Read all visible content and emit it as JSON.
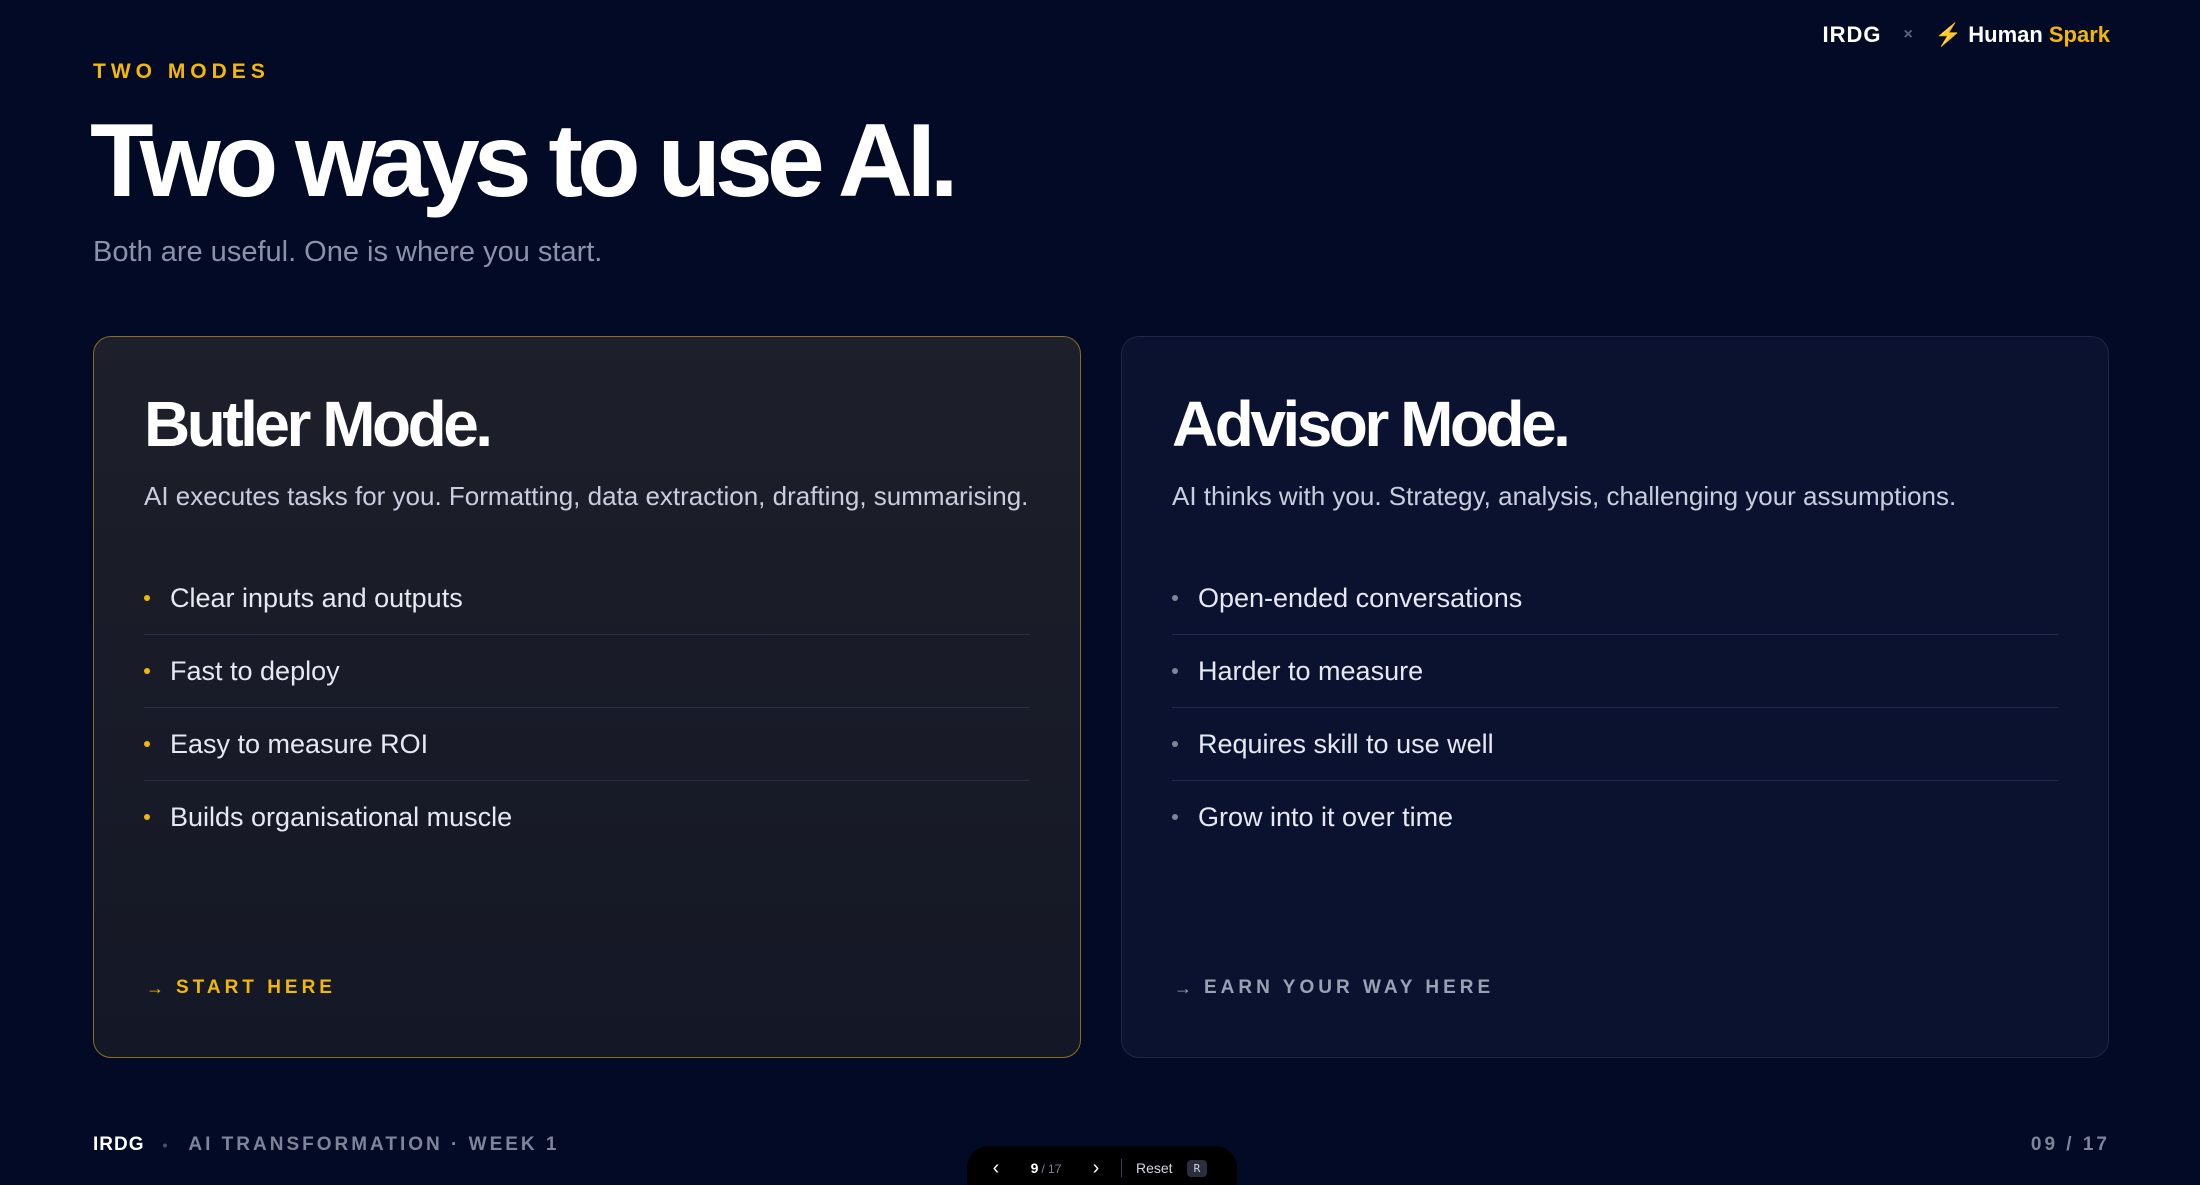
{
  "brand": {
    "org": "IRDG",
    "separator": "×",
    "bolt_icon": "⚡",
    "partner_first": "Human",
    "partner_second": "Spark"
  },
  "eyebrow": "TWO MODES",
  "headline": "Two ways to use AI.",
  "subhead": "Both are useful. One is where you start.",
  "cards": [
    {
      "title": "Butler Mode.",
      "description": "AI executes tasks for you. Formatting, data extraction, drafting, summarising.",
      "items": [
        "Clear inputs and outputs",
        "Fast to deploy",
        "Easy to measure ROI",
        "Builds organisational muscle"
      ],
      "cta_arrow": "→",
      "cta": "START HERE"
    },
    {
      "title": "Advisor Mode.",
      "description": "AI thinks with you. Strategy, analysis, challenging your assumptions.",
      "items": [
        "Open-ended conversations",
        "Harder to measure",
        "Requires skill to use well",
        "Grow into it over time"
      ],
      "cta_arrow": "→",
      "cta": "EARN YOUR WAY HERE"
    }
  ],
  "footer": {
    "org": "IRDG",
    "bullet": "•",
    "course": "AI TRANSFORMATION · WEEK 1",
    "page_indicator": "09 / 17"
  },
  "nav": {
    "prev_icon": "‹",
    "next_icon": "›",
    "current": "9",
    "total": "/ 17",
    "reset_label": "Reset",
    "reset_key": "R"
  },
  "colors": {
    "background": "#020a26",
    "accent": "#f5b800",
    "muted_text": "#8b93ab"
  }
}
